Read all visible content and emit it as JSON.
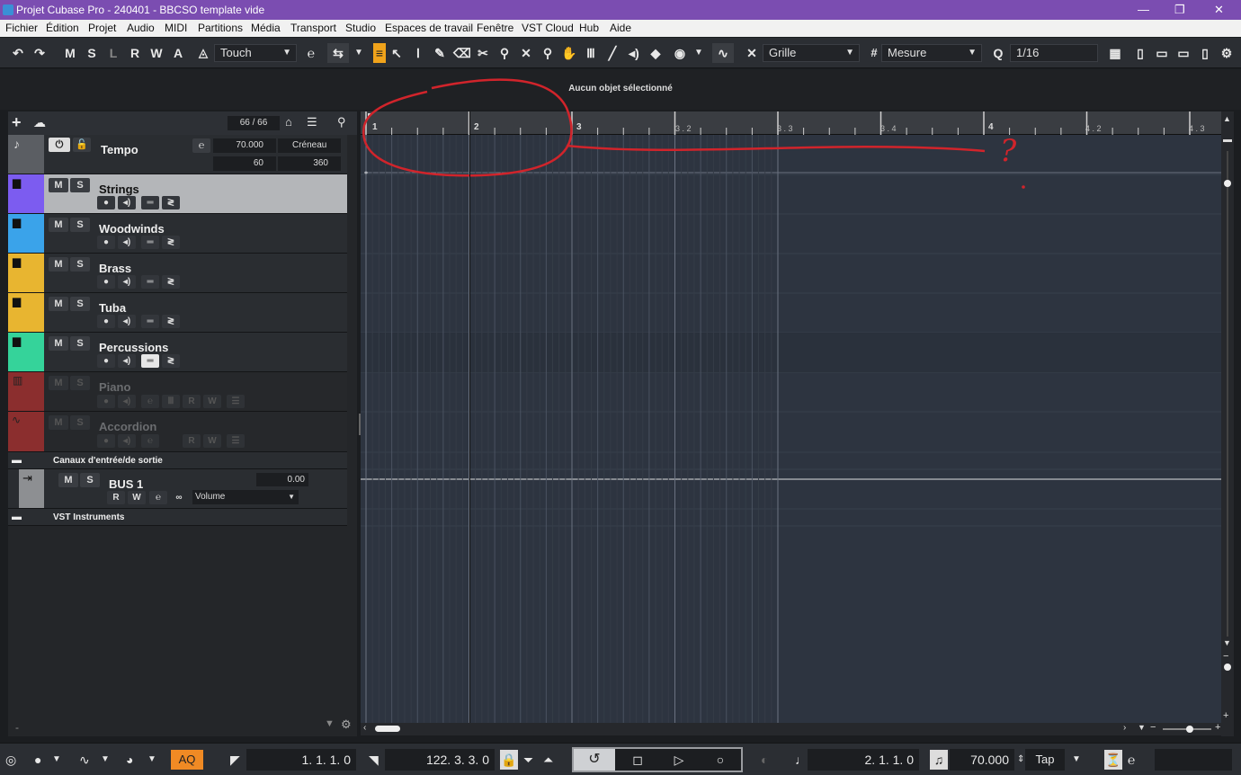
{
  "window": {
    "title": "Projet Cubase Pro - 240401 - BBCSO template vide",
    "minimize": "—",
    "maximize": "❐",
    "close": "✕"
  },
  "menu": [
    "Fichier",
    "Édition",
    "Projet",
    "Audio",
    "MIDI",
    "Partitions",
    "Média",
    "Transport",
    "Studio",
    "Espaces de travail",
    "Fenêtre",
    "VST Cloud",
    "Hub",
    "Aide"
  ],
  "toolbar": {
    "letters": [
      "M",
      "S",
      "L",
      "R",
      "W",
      "A"
    ],
    "automation_mode": "Touch",
    "snap_type": "Grille",
    "grid_type": "Mesure",
    "quantize": "1/16"
  },
  "info_line": "Aucun objet sélectionné",
  "track_count": "66 / 66",
  "tempo_track": {
    "name": "Tempo",
    "value": "70.000",
    "mode": "Créneau",
    "min": "60",
    "max": "360"
  },
  "tracks": [
    {
      "name": "Strings",
      "color": "#7c5cf0",
      "selected": true
    },
    {
      "name": "Woodwinds",
      "color": "#3aa3ea"
    },
    {
      "name": "Brass",
      "color": "#e8b530"
    },
    {
      "name": "Tuba",
      "color": "#e8b530"
    },
    {
      "name": "Percussions",
      "color": "#35d39a"
    },
    {
      "name": "Piano",
      "color": "#8b2e2e",
      "disabled": true
    },
    {
      "name": "Accordion",
      "color": "#8b2e2e",
      "disabled": true
    }
  ],
  "io_folder": "Canaux d'entrée/de sortie",
  "bus": {
    "name": "BUS 1",
    "value": "0.00",
    "param": "Volume"
  },
  "vst_folder": "VST Instruments",
  "ruler": {
    "bars": [
      "1",
      "2",
      "3",
      "4"
    ],
    "sub": [
      "3 . 2",
      "3 . 3",
      "3 . 4",
      "4 . 2",
      "4 . 3"
    ]
  },
  "annotation": "?",
  "transport": {
    "aq": "AQ",
    "left_locator": "1.   1.   1.     0",
    "right_locator": "122.   3.   3.     0",
    "position": "2.   1.   1.     0",
    "tempo": "70.000",
    "tap": "Tap"
  },
  "footer_dash": "-"
}
